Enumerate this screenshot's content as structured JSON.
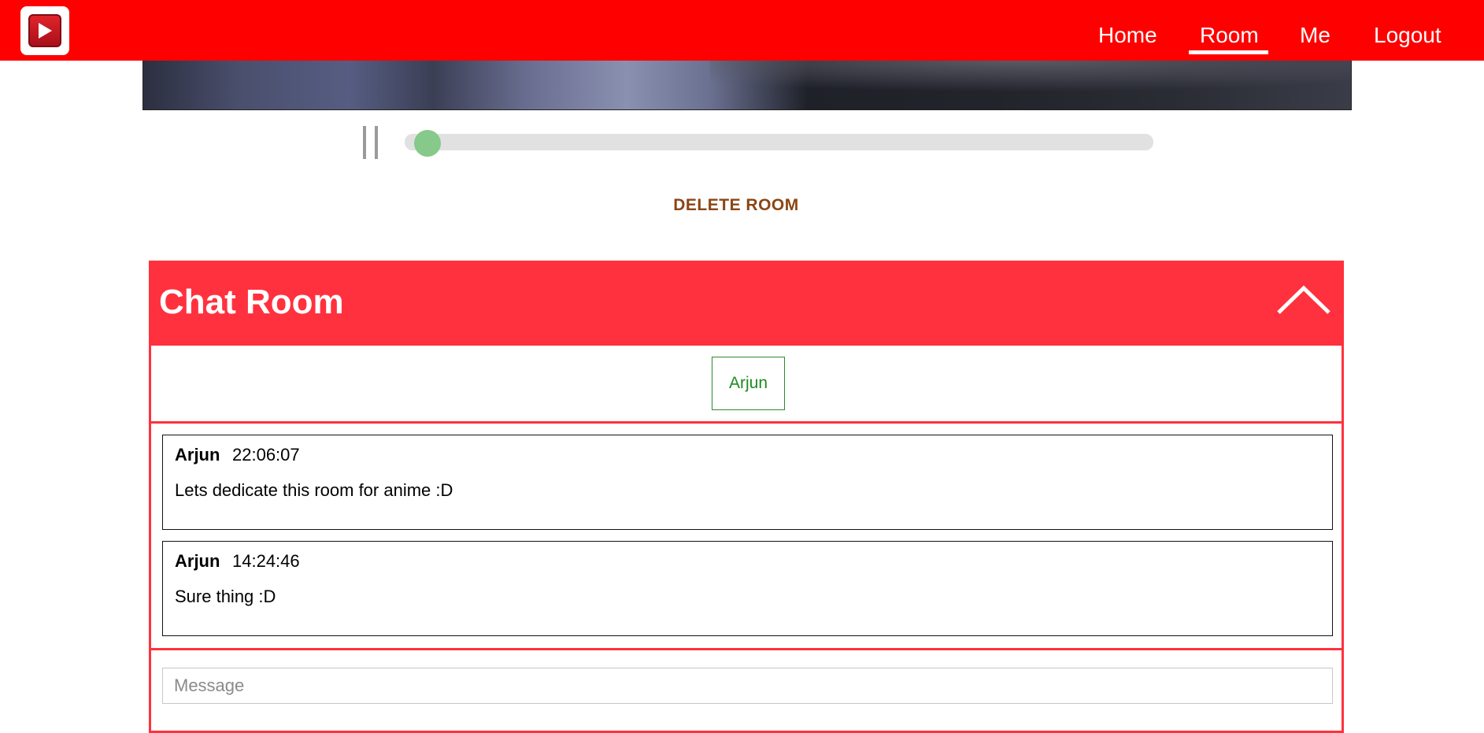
{
  "nav": {
    "links": [
      {
        "label": "Home"
      },
      {
        "label": "Room",
        "active": true
      },
      {
        "label": "Me"
      },
      {
        "label": "Logout"
      }
    ]
  },
  "player": {
    "progress_fraction": 0.03,
    "state": "playing"
  },
  "room": {
    "delete_label": "DELETE ROOM"
  },
  "chat": {
    "title": "Chat Room",
    "users": [
      "Arjun"
    ],
    "messages": [
      {
        "author": "Arjun",
        "time": "22:06:07",
        "text": "Lets dedicate this room for anime :D"
      },
      {
        "author": "Arjun",
        "time": "14:24:46",
        "text": "Sure thing :D"
      }
    ],
    "input": {
      "placeholder": "Message",
      "value": ""
    }
  },
  "colors": {
    "navbar": "#ff0000",
    "chat_accent": "#ff313e",
    "delete_text": "#8b4513",
    "seek_thumb": "#86c98a",
    "user_chip": "#1f8a1f"
  },
  "icons": {
    "logo": "play-logo-icon",
    "pause": "pause-icon",
    "collapse": "chevron-up-icon"
  }
}
